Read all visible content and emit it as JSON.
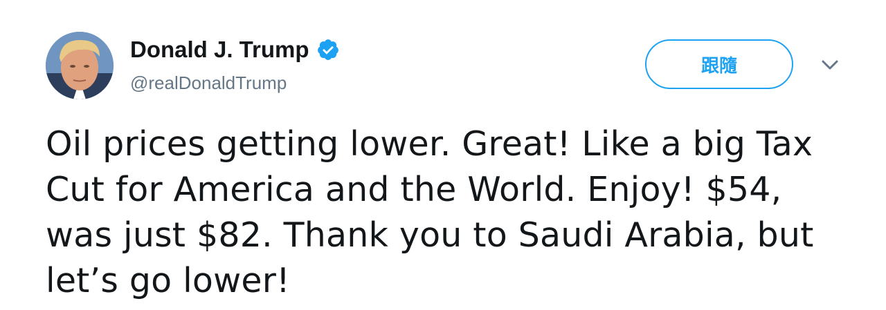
{
  "tweet": {
    "author": {
      "display_name": "Donald J. Trump",
      "handle": "@realDonaldTrump",
      "verified": true
    },
    "follow_button_label": "跟隨",
    "menu_icon": "chevron-down-icon",
    "text_lines": [
      "Oil prices getting lower. Great! Like a big Tax",
      "Cut for America and the World. Enjoy! $54,",
      "was just $82. Thank you to Saudi Arabia, but",
      "let’s go lower!"
    ]
  },
  "colors": {
    "accent": "#1da1f2",
    "text_primary": "#14171a",
    "text_secondary": "#657786",
    "background": "#ffffff"
  }
}
